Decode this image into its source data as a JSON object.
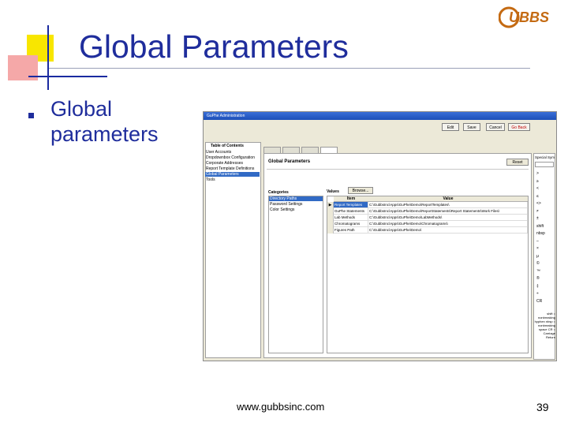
{
  "slide": {
    "title": "Global Parameters",
    "bullet": "Global parameters",
    "footer_url": "www.gubbsinc.com",
    "page_number": "39",
    "logo_text": "GUBBS",
    "colors": {
      "title": "#1f2d9c",
      "deco_yellow": "#f8e600",
      "deco_pink": "#f5a8a8"
    }
  },
  "screenshot": {
    "window_title": "GuPhe Administration",
    "toolbar": {
      "edit": "Edit",
      "save": "Save",
      "cancel": "Cancel",
      "go_back": "Go Back"
    },
    "toc": {
      "heading": "Table of Contents",
      "items": [
        "User Accounts",
        "Dropdownbox Configuration",
        "Corporate Addresses",
        "Report Template Definitions",
        "Global Parameters",
        "Tools"
      ],
      "selected_index": 4
    },
    "panel": {
      "title": "Global Parameters",
      "reset": "Reset",
      "categories_label": "Categories",
      "categories": [
        "Directory Paths",
        "Password Settings",
        "Color Settings"
      ],
      "selected_category": 0,
      "values_label": "Values",
      "browse": "Browse...",
      "columns": [
        "Item",
        "Value"
      ],
      "rows": [
        {
          "item": "Report Templates",
          "value": "C:\\GubbsInc\\Apps\\GuPhe\\Demo\\ReportTemplates\\"
        },
        {
          "item": "GuPhe Statements",
          "value": "C:\\GubbsInc\\Apps\\GuPhe\\Demo\\ReportStatements\\Report Statements\\Work Files\\"
        },
        {
          "item": "Lab Methods",
          "value": "C:\\GubbsInc\\Apps\\GuPhe\\Demo\\LabMethods\\"
        },
        {
          "item": "Chromatograms",
          "value": "C:\\GubbsInc\\Apps\\GuPhe\\Demo\\Chromatograms\\"
        },
        {
          "item": "Figures Path",
          "value": "C:\\GubbsInc\\Apps\\GuPhe\\Demo\\"
        }
      ],
      "selected_row": 0
    },
    "symbols": {
      "heading": "Special Sym",
      "items": [
        ">",
        "≥",
        "<",
        "≤",
        "<>",
        "≠",
        "±",
        "shift",
        "nbsp",
        "–",
        "×",
        "μ",
        "©",
        "™",
        "®",
        "‡",
        "÷",
        "CR"
      ],
      "note": "shift = nonbreaking hyphen nbsp = nonbreaking space CR = Carriage Return"
    }
  }
}
